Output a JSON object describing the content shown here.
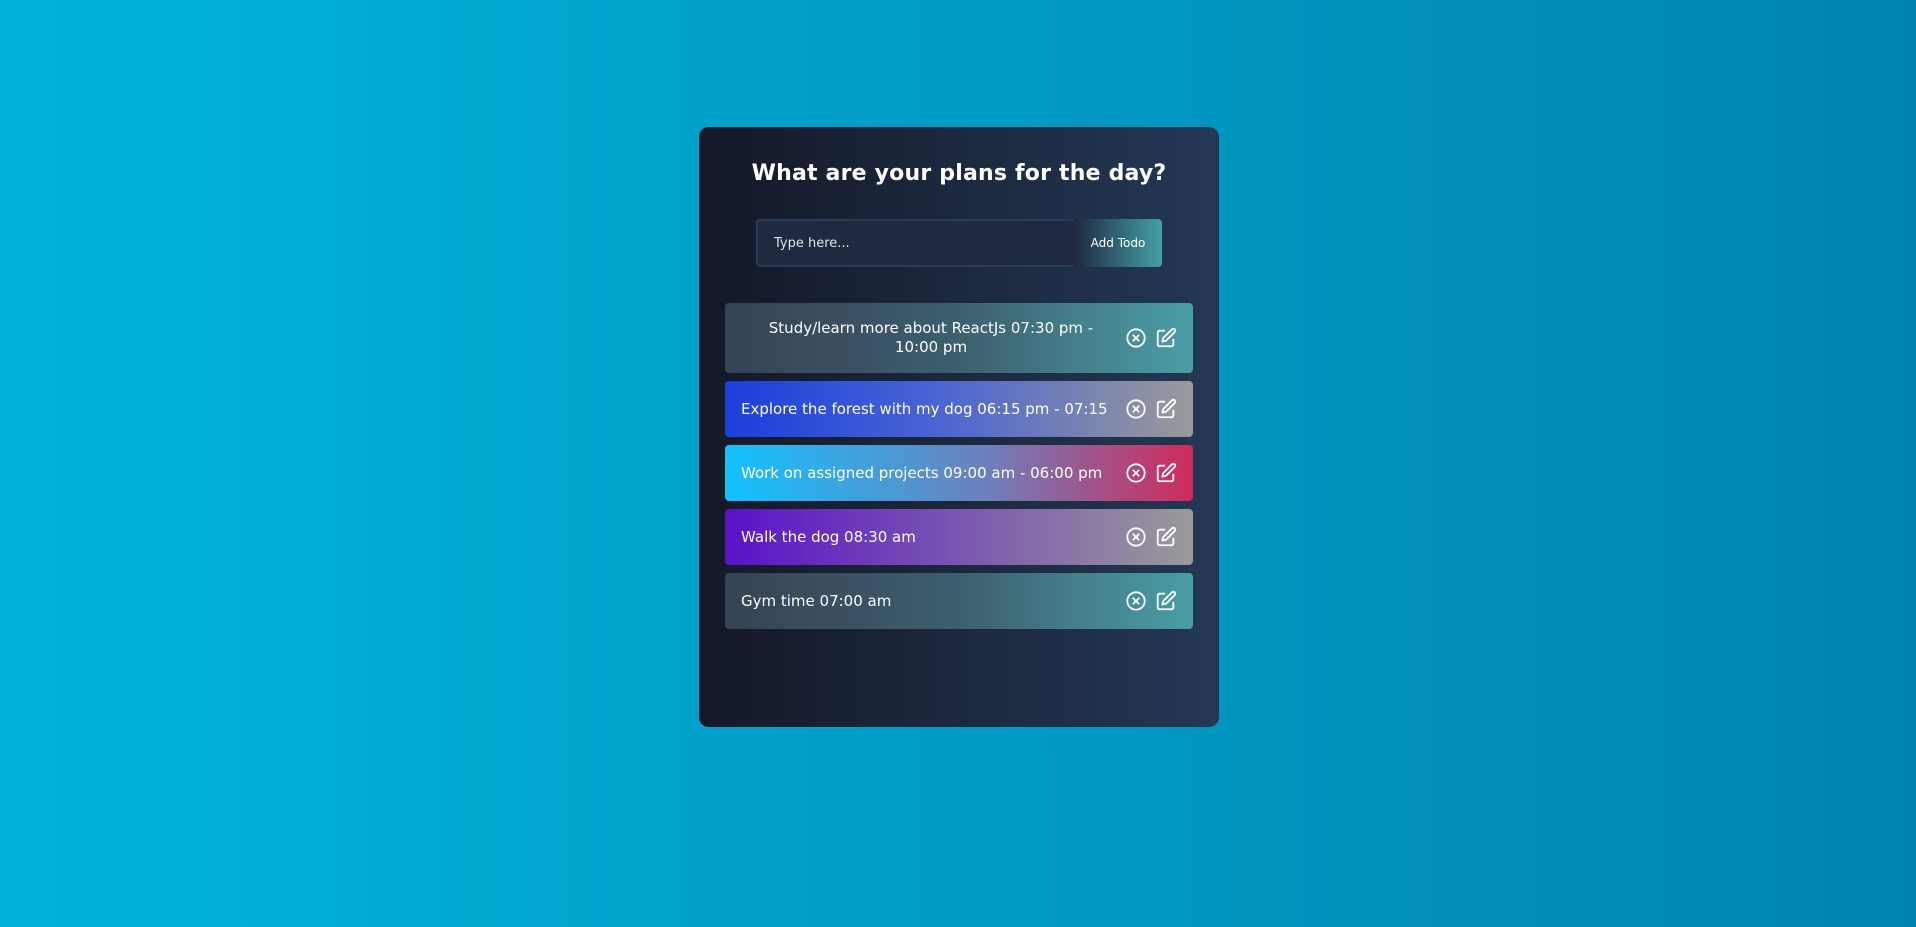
{
  "app": {
    "title": "What are your plans for the day?"
  },
  "form": {
    "input_placeholder": "Type here...",
    "input_value": "",
    "add_button_label": "Add Todo"
  },
  "todos": [
    {
      "text": "Study/learn more about ReactJs 07:30 pm - 10:00 pm",
      "gradient": [
        "#374255",
        "#4a9ea5"
      ]
    },
    {
      "text": "Explore the forest with my dog 06:15 pm - 07:15",
      "gradient": [
        "#1a3fdc",
        "#9a9a9a"
      ]
    },
    {
      "text": "Work on assigned projects 09:00 am - 06:00 pm",
      "gradient": [
        "#12c2ff",
        "#d02a5c"
      ]
    },
    {
      "text": "Walk the dog 08:30 am",
      "gradient": [
        "#5a12c9",
        "#9a9a9a"
      ]
    },
    {
      "text": "Gym time 07:00 am",
      "gradient": [
        "#374255",
        "#4a9ea5"
      ]
    }
  ],
  "icons": {
    "delete": "close-circle-icon",
    "edit": "edit-icon"
  },
  "colors": {
    "background_start": "#00b4db",
    "background_end": "#0083b0",
    "panel": "#161a2b"
  }
}
